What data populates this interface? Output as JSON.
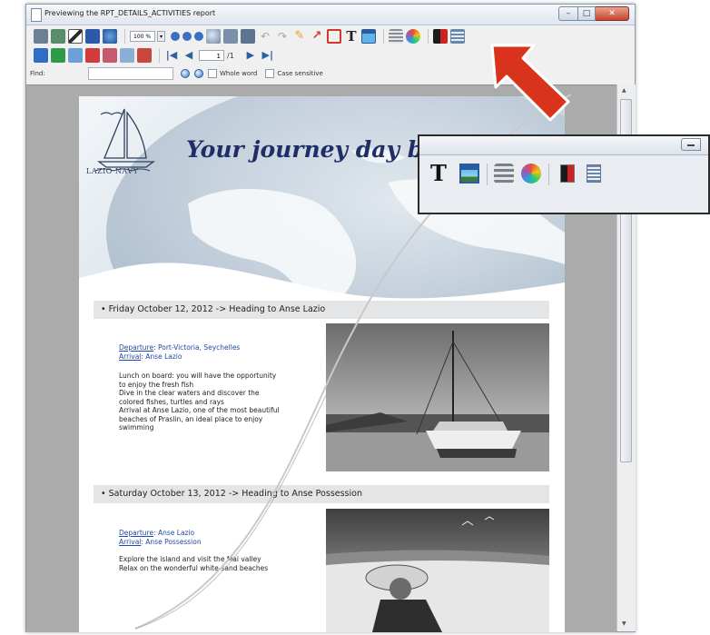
{
  "window": {
    "title": "Previewing the RPT_DETAILS_ACTIVITIES report"
  },
  "toolbar": {
    "zoom_value": "100 %",
    "page_current": "1",
    "page_total": "/1"
  },
  "find": {
    "label": "Find:",
    "whole_word_label": "Whole word",
    "case_sensitive_label": "Case sensitive"
  },
  "report": {
    "logo_text": "Lazio Navy",
    "headline": "Your journey day by day",
    "days": [
      {
        "heading": "Friday October 12, 2012 -> Heading to Anse Lazio",
        "departure_label": "Departure",
        "departure_value": ": Port-Victoria, Seychelles",
        "arrival_label": "Arrival",
        "arrival_value": ": Anse Lazio",
        "description": [
          "Lunch on board: you will have the opportunity",
          "to enjoy the fresh fish",
          "Dive in the clear waters and discover the",
          "colored fishes, turtles and rays",
          "Arrival at Anse Lazio, one of the most beautiful",
          "beaches of Praslin, an ideal place to enjoy",
          "swimming"
        ]
      },
      {
        "heading": "Saturday October 13, 2012 -> Heading to Anse Possession",
        "departure_label": "Departure",
        "departure_value": ": Anse Lazio",
        "arrival_label": "Arrival",
        "arrival_value": ": Anse Possession",
        "description": [
          "Explore the island and visit the Mai valley",
          "Relax on the wonderful white-sand beaches"
        ]
      }
    ]
  },
  "colors": {
    "headline": "#1f2f66",
    "link": "#2149a6",
    "arrow": "#d9331c"
  }
}
